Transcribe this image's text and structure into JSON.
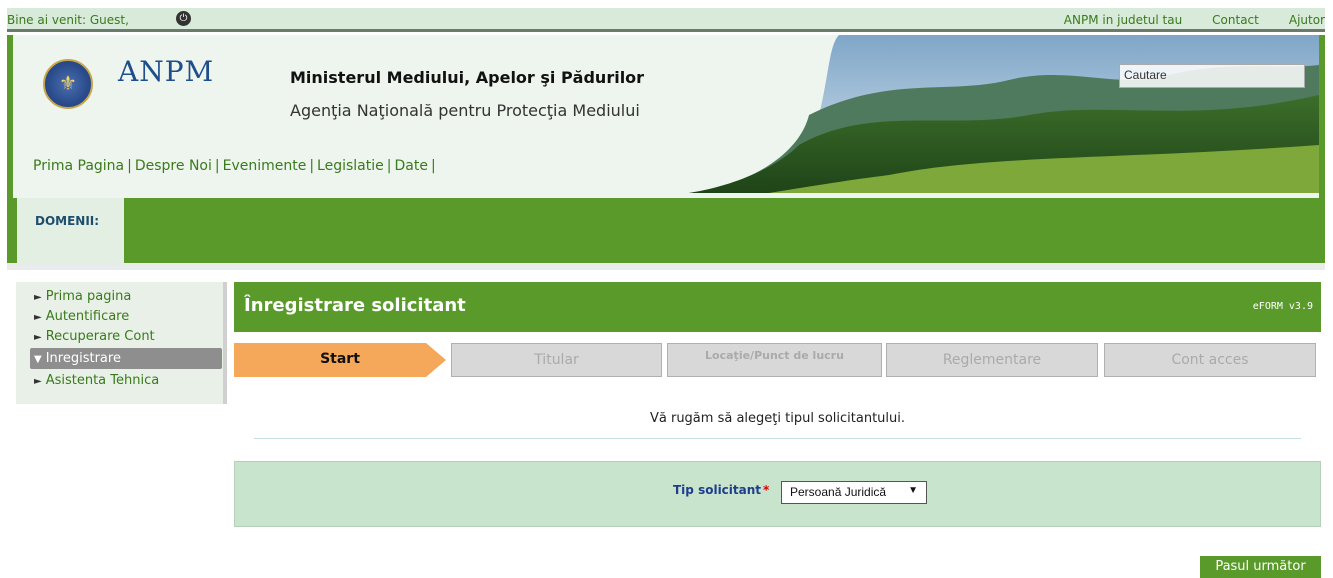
{
  "topbar": {
    "welcome": "Bine ai venit: Guest,",
    "links": [
      "ANPM in judetul tau",
      "Contact",
      "Ajutor"
    ]
  },
  "header": {
    "logo_text": "ANPM",
    "ministry": "Ministerul Mediului, Apelor şi Pădurilor",
    "agency": "Agenţia Naţională pentru Protecţia Mediului",
    "nav": [
      "Prima Pagina",
      "Despre Noi",
      "Evenimente",
      "Legislatie",
      "Date"
    ],
    "search_placeholder": "Cautare"
  },
  "domains": {
    "label": "DOMENII:"
  },
  "sidebar": {
    "items": [
      {
        "label": "Prima pagina",
        "active": false
      },
      {
        "label": "Autentificare",
        "active": false
      },
      {
        "label": "Recuperare Cont",
        "active": false
      },
      {
        "label": "Inregistrare",
        "active": true
      },
      {
        "label": "Asistenta Tehnica",
        "active": false
      }
    ]
  },
  "panel": {
    "title": "Înregistrare solicitant",
    "version": "eFORM v3.9"
  },
  "steps": [
    {
      "label": "Start",
      "active": true
    },
    {
      "label": "Titular",
      "active": false
    },
    {
      "label": "Locaţie/Punct de lucru",
      "active": false
    },
    {
      "label": "Reglementare",
      "active": false
    },
    {
      "label": "Cont acces",
      "active": false
    }
  ],
  "form": {
    "hint": "Vă rugăm să alegeţi tipul solicitantului.",
    "tip_label": "Tip solicitant",
    "required_mark": "*",
    "tip_value": "Persoană Juridică"
  },
  "next_button": "Pasul următor",
  "colors": {
    "brand_green": "#5a9a2b",
    "step_active": "#f5a85a"
  }
}
